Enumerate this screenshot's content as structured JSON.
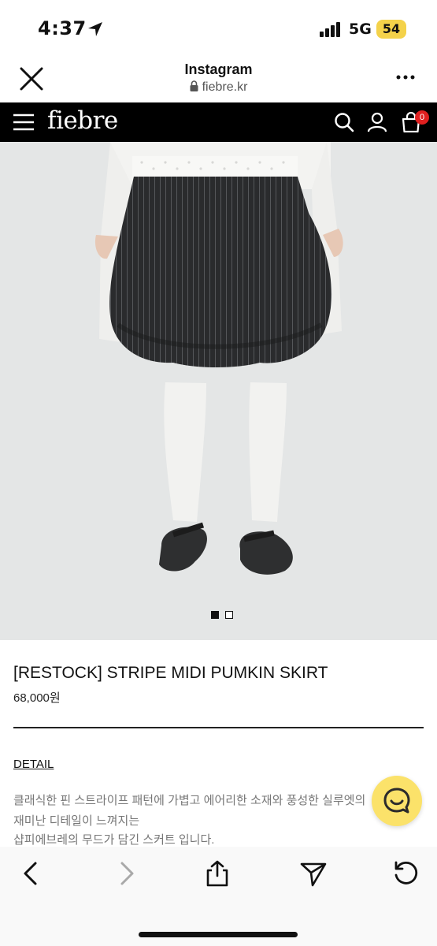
{
  "status_bar": {
    "time": "4:37",
    "network": "5G",
    "battery": "54",
    "icons": [
      "location-arrow-icon",
      "signal-bars-icon"
    ]
  },
  "browser_header": {
    "title": "Instagram",
    "url": "fiebre.kr",
    "icons": [
      "close-icon",
      "lock-icon",
      "more-icon"
    ]
  },
  "site_nav": {
    "logo": "fiebre",
    "cart_count": "0",
    "icons": [
      "menu-icon",
      "search-icon",
      "user-icon",
      "cart-icon"
    ]
  },
  "product": {
    "image": "product photo: model wearing black pinstripe balloon skirt, white knee socks, black ballet flats",
    "slides_total": 2,
    "slide_active": 1,
    "name": "[RESTOCK] STRIPE MIDI PUMKIN SKIRT",
    "price": "68,000원",
    "detail_label": "DETAIL",
    "description": [
      "클래식한 핀 스트라이프 패턴에 가볍고 에어리한 소재와 풍성한 실루엣의",
      "재미난 디테일이 느껴지는",
      "샵피에브레의 무드가 담긴 스커트 입니다."
    ]
  },
  "chat": {
    "icon": "chat-icon"
  },
  "bottom_toolbar": {
    "icons": [
      "back-icon",
      "forward-icon",
      "share-icon",
      "send-icon",
      "reload-icon"
    ]
  },
  "colors": {
    "nav_background": "#000000",
    "cart_badge": "#e02020",
    "chat_button": "#fbe26a",
    "battery": "#f4d24a"
  }
}
